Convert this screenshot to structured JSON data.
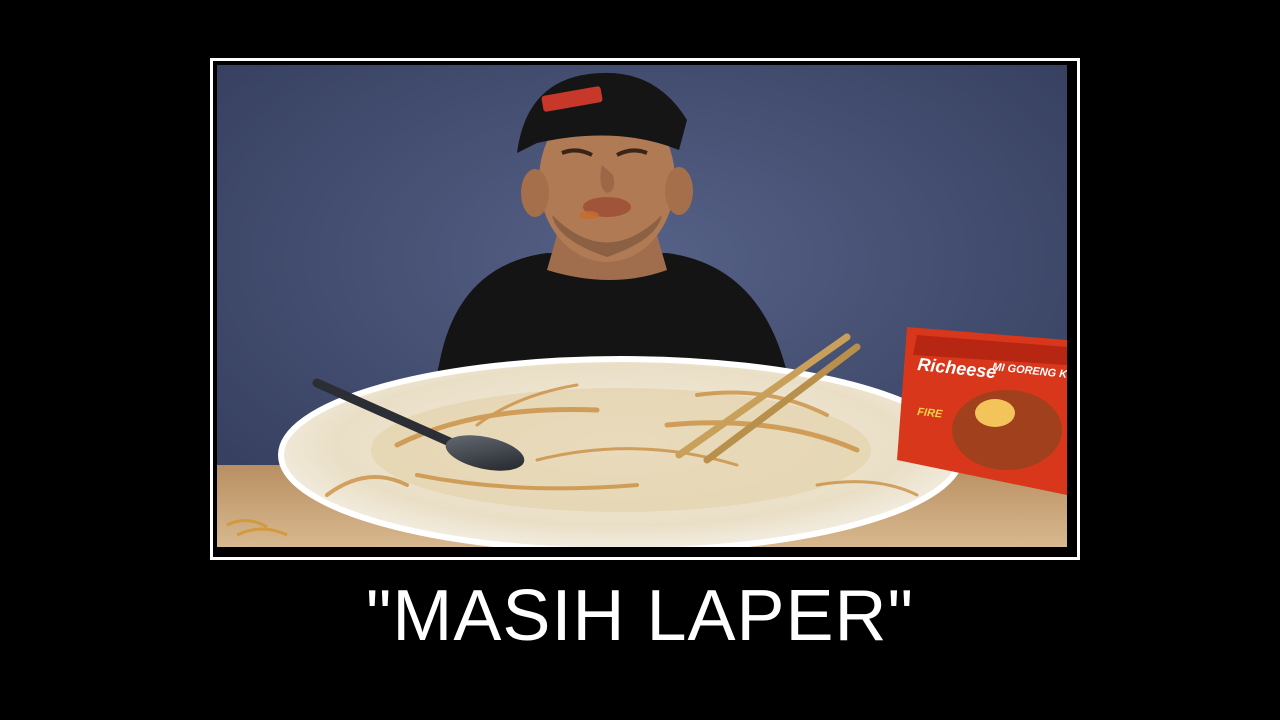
{
  "caption": "\"MASIH LAPER\"",
  "photo": {
    "package_brand": "Richeese",
    "package_product": "MI GORENG KEJU PEDAS",
    "package_flavor": "FIRE",
    "colors": {
      "background_wall": "#3f4a6e",
      "shirt": "#141414",
      "plate": "#efe9dc",
      "sauce": "#c98a3a",
      "package": "#d8371c",
      "table": "#c9a57a"
    }
  }
}
